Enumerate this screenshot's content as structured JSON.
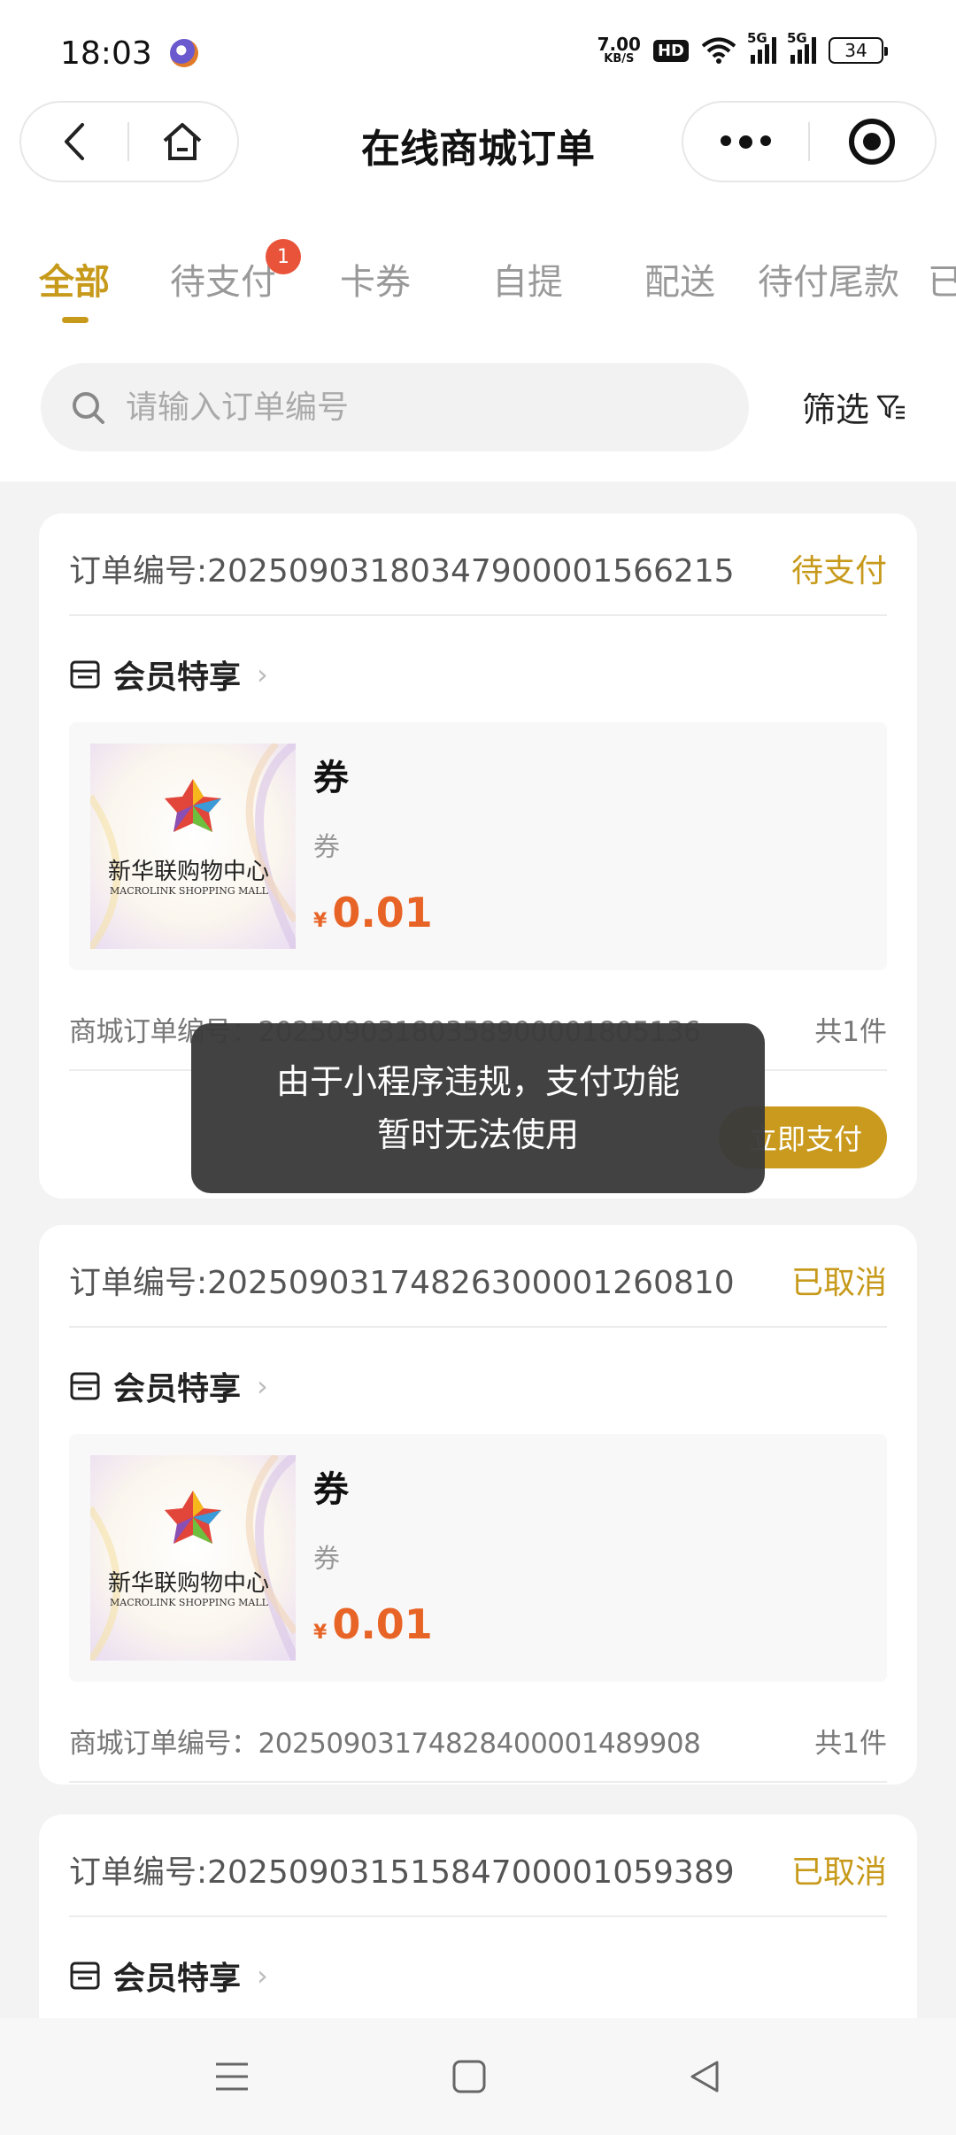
{
  "status_bar": {
    "time": "18:03",
    "net_speed_value": "7.00",
    "net_speed_unit": "KB/S",
    "hd_label": "HD",
    "signal1_label": "5G",
    "signal2_label": "5G",
    "battery": "34"
  },
  "navbar": {
    "title": "在线商城订单"
  },
  "tabs": [
    {
      "label": "全部",
      "active": true
    },
    {
      "label": "待支付",
      "badge": "1"
    },
    {
      "label": "卡券"
    },
    {
      "label": "自提"
    },
    {
      "label": "配送"
    },
    {
      "label": "待付尾款"
    },
    {
      "label": "已"
    }
  ],
  "search": {
    "placeholder": "请输入订单编号",
    "filter_label": "筛选"
  },
  "orders": [
    {
      "order_no": "订单编号:2025090318034790000156621​5",
      "status": "待支付",
      "shop": "会员特享",
      "product_name": "券",
      "product_spec": "券",
      "currency": "¥",
      "price": "0.01",
      "thumb_brand_cn": "新华联购物中心",
      "thumb_brand_en": "MACROLINK SHOPPING MALL",
      "mall_order_label": "商城订单编号：",
      "mall_order_no": "2025090318035890000180513​6",
      "count": "共1件",
      "pay_button": "立即支付"
    },
    {
      "order_no": "订单编号:2025090317482630000126081​0",
      "status": "已取消",
      "shop": "会员特享",
      "product_name": "券",
      "product_spec": "券",
      "currency": "¥",
      "price": "0.01",
      "thumb_brand_cn": "新华联购物中心",
      "thumb_brand_en": "MACROLINK SHOPPING MALL",
      "mall_order_label": "商城订单编号：",
      "mall_order_no": "2025090317482840000148990​8",
      "count": "共1件"
    },
    {
      "order_no": "订单编号:2025090315158470000105938​9",
      "status": "已取消",
      "shop": "会员特享"
    }
  ],
  "toast": {
    "line1": "由于小程序违规，支付功能",
    "line2": "暂时无法使用"
  },
  "colors": {
    "accent": "#c79a1b",
    "price": "#e86426",
    "badge": "#e8533a",
    "toast_bg": "#3a3a3a"
  },
  "icons": {
    "back": "chevron-left-icon",
    "home": "home-icon",
    "more": "more-dots-icon",
    "close": "target-close-icon",
    "search": "search-icon",
    "filter": "filter-icon",
    "shop": "store-icon"
  }
}
